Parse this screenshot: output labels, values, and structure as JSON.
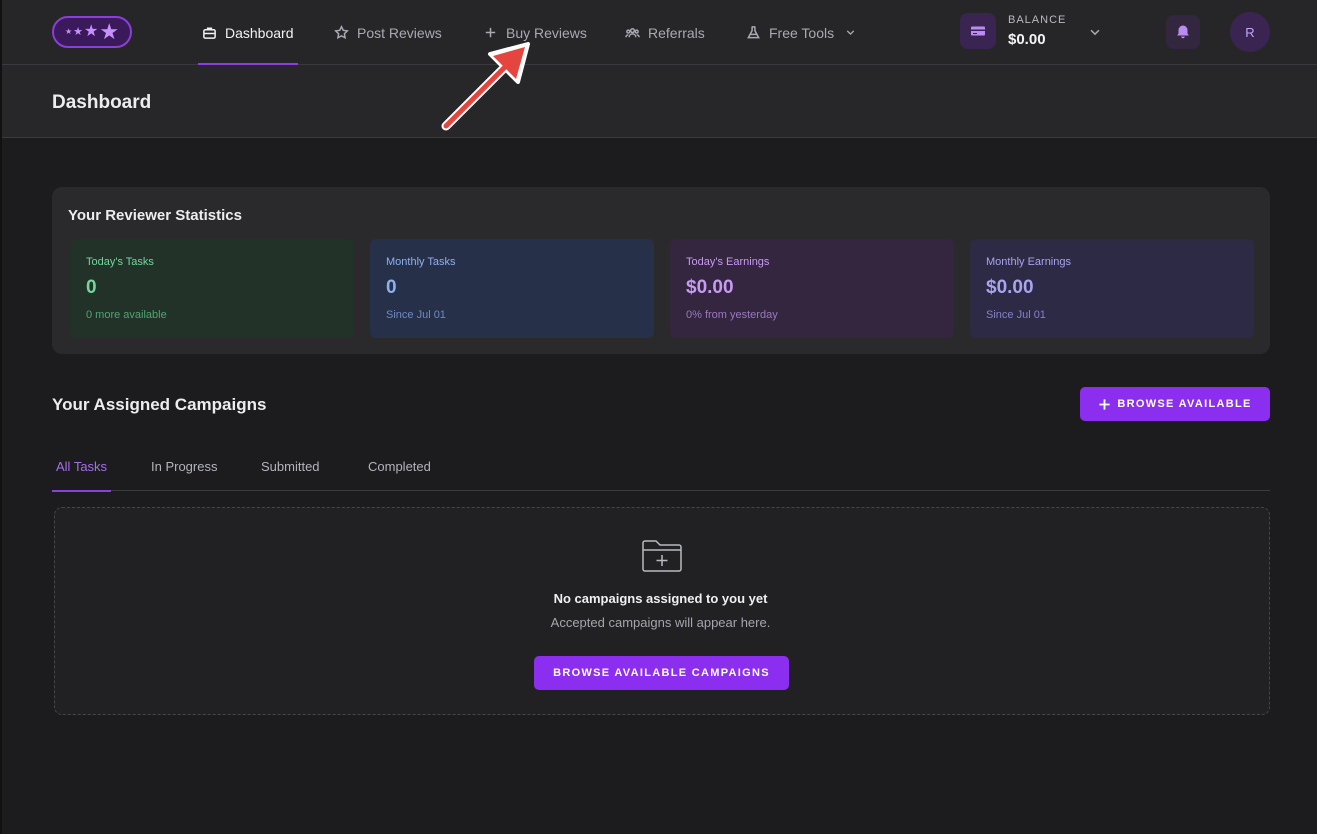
{
  "nav": {
    "items": [
      {
        "label": "Dashboard",
        "icon": "briefcase-icon",
        "active": true
      },
      {
        "label": "Post Reviews",
        "icon": "star-icon"
      },
      {
        "label": "Buy Reviews",
        "icon": "plus-icon"
      },
      {
        "label": "Referrals",
        "icon": "users-icon"
      },
      {
        "label": "Free Tools",
        "icon": "flask-icon"
      }
    ],
    "balance_label": "BALANCE",
    "balance_value": "$0.00",
    "avatar_initial": "R"
  },
  "header": {
    "title": "Dashboard"
  },
  "stats": {
    "title": "Your Reviewer Statistics",
    "cards": [
      {
        "label": "Today's Tasks",
        "value": "0",
        "sub": "0 more available"
      },
      {
        "label": "Monthly Tasks",
        "value": "0",
        "sub": "Since Jul 01"
      },
      {
        "label": "Today's Earnings",
        "value": "$0.00",
        "sub": "0% from yesterday"
      },
      {
        "label": "Monthly Earnings",
        "value": "$0.00",
        "sub": "Since Jul 01"
      }
    ]
  },
  "campaigns": {
    "title": "Your Assigned Campaigns",
    "browse_label": "BROWSE AVAILABLE",
    "tabs": [
      "All Tasks",
      "In Progress",
      "Submitted",
      "Completed"
    ],
    "empty_title": "No campaigns assigned to you yet",
    "empty_sub": "Accepted campaigns will appear here.",
    "empty_button": "BROWSE AVAILABLE CAMPAIGNS"
  },
  "colors": {
    "accent": "#8b2ef0",
    "annotation_arrow": "#e5453f"
  }
}
